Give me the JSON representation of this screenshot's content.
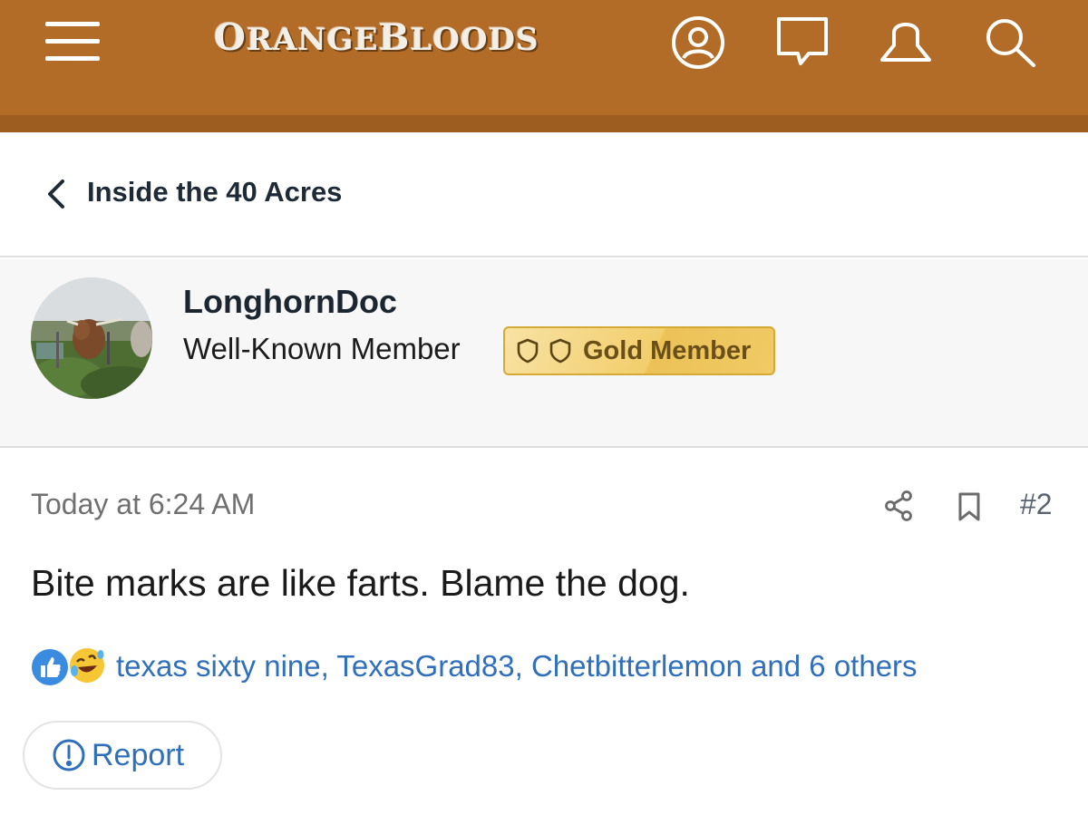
{
  "header": {
    "logo_text": "ORANGEBLOODS",
    "logo_part1": "O",
    "logo_part2": "RANGE",
    "logo_part3": "B",
    "logo_part4": "LOODS",
    "icons": [
      "menu-icon",
      "account-icon",
      "messages-icon",
      "alerts-icon",
      "search-icon"
    ],
    "bg_color": "#b26c28"
  },
  "breadcrumb": {
    "label": "Inside the 40 Acres"
  },
  "user": {
    "username": "LonghornDoc",
    "title": "Well-Known Member",
    "badge": "Gold Member"
  },
  "post": {
    "time": "Today at 6:24 AM",
    "number": "#2",
    "body": "Bite marks are like farts. Blame the dog.",
    "reaction_icons": [
      "like-reaction-icon",
      "laugh-reaction-icon"
    ],
    "reaction_users": "texas sixty nine, TexasGrad83, Chetbitterlemon and 6 others",
    "report_label": "Report"
  },
  "colors": {
    "accent_link": "#2f6fbb",
    "gold_badge": "#f2ce6c"
  }
}
